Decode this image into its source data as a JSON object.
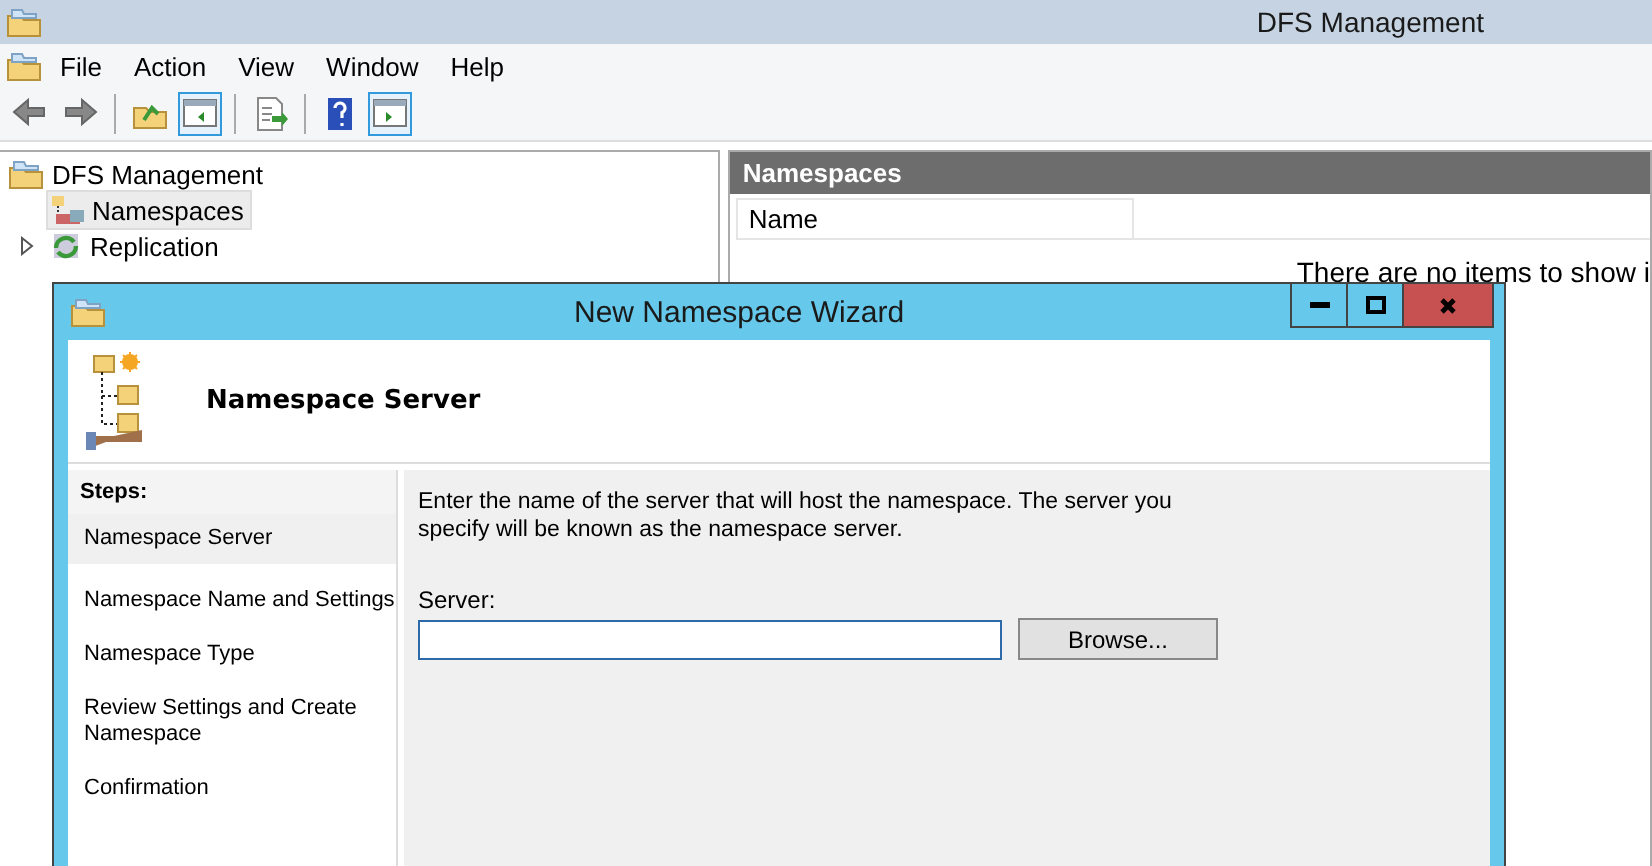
{
  "window": {
    "title": "DFS Management"
  },
  "menu": [
    "File",
    "Action",
    "View",
    "Window",
    "Help"
  ],
  "toolbar": [
    {
      "kind": "back",
      "selected": false
    },
    {
      "kind": "forward",
      "selected": false
    },
    {
      "kind": "sep"
    },
    {
      "kind": "up",
      "selected": false
    },
    {
      "kind": "pane",
      "selected": true
    },
    {
      "kind": "sep"
    },
    {
      "kind": "export",
      "selected": false
    },
    {
      "kind": "sep"
    },
    {
      "kind": "help",
      "selected": false
    },
    {
      "kind": "pane2",
      "selected": true
    }
  ],
  "tree": {
    "label": "DFS Management",
    "children": [
      {
        "label": "Namespaces",
        "selected": true,
        "expandable": false
      },
      {
        "label": "Replication",
        "selected": false,
        "expandable": true
      }
    ]
  },
  "details": {
    "header": "Namespaces",
    "columns": [
      "Name"
    ],
    "empty_text": "There are no items to show i"
  },
  "wizard": {
    "title": "New Namespace Wizard",
    "page_title": "Namespace Server",
    "steps_header": "Steps:",
    "steps": [
      {
        "label": "Namespace Server",
        "selected": true
      },
      {
        "label": "Namespace Name and Settings",
        "selected": false
      },
      {
        "label": "Namespace Type",
        "selected": false
      },
      {
        "label": "Review Settings and Create Namespace",
        "selected": false
      },
      {
        "label": "Confirmation",
        "selected": false
      }
    ],
    "instructions": "Enter the name of the server that will host the namespace. The server you specify will be known as the namespace server.",
    "server_label": "Server:",
    "browse": "Browse..."
  }
}
